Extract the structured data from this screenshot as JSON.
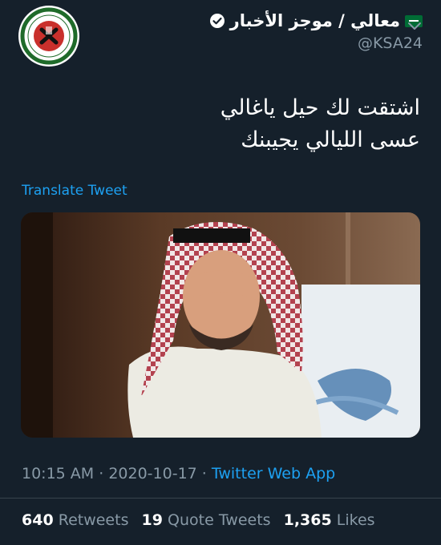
{
  "tweet": {
    "author": {
      "display_name": "معالي / موجز الأخبار",
      "handle": "@KSA24",
      "verified": true,
      "flag_icon": "saudi-flag-icon",
      "avatar_icon": "emblem-avatar"
    },
    "text_lines": [
      "اشتقت لك حيل ياغالي",
      "عسى الليالي يجيبنك"
    ],
    "translate_label": "Translate Tweet",
    "media": {
      "kind": "photo"
    },
    "time": "10:15 AM",
    "date": "2020-10-17",
    "separator": "·",
    "source": "Twitter Web App",
    "stats": {
      "retweets_count": "640",
      "retweets_label": "Retweets",
      "quotes_count": "19",
      "quotes_label": "Quote Tweets",
      "likes_count": "1,365",
      "likes_label": "Likes"
    }
  },
  "colors": {
    "background": "#15202b",
    "primary_text": "#ffffff",
    "secondary_text": "#8899a6",
    "link": "#1da1f2",
    "divider": "#38444d"
  }
}
